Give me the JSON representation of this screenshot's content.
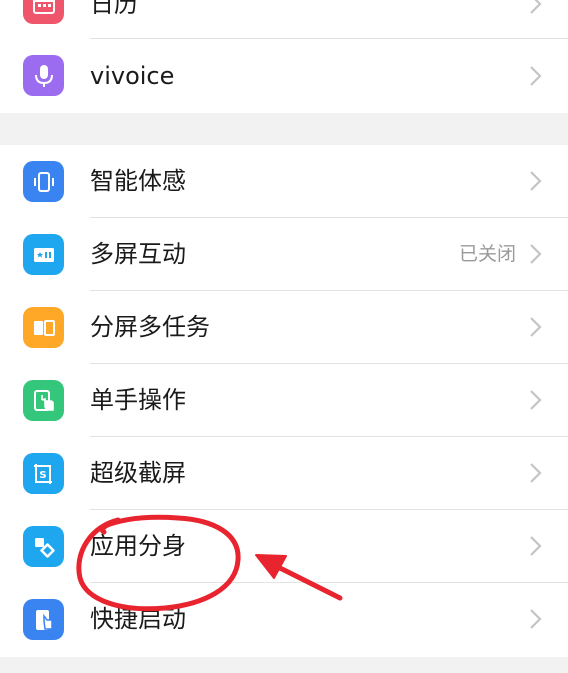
{
  "colors": {
    "calendar": "#f0566b",
    "vivoice": "#9b6cf0",
    "blue": "#3a84f2",
    "cyan": "#1ea7ee",
    "orange": "#ffa726",
    "green": "#34c77b",
    "annotation": "#e8252f"
  },
  "top_group": {
    "items": [
      {
        "label": "日历",
        "icon": "calendar-icon"
      },
      {
        "label": "vivoice",
        "icon": "microphone-icon"
      }
    ]
  },
  "main_group": {
    "items": [
      {
        "label": "智能体感",
        "icon": "phone-motion-icon",
        "status": ""
      },
      {
        "label": "多屏互动",
        "icon": "screen-cast-icon",
        "status": "已关闭"
      },
      {
        "label": "分屏多任务",
        "icon": "split-screen-icon",
        "status": ""
      },
      {
        "label": "单手操作",
        "icon": "one-hand-icon",
        "status": ""
      },
      {
        "label": "超级截屏",
        "icon": "screenshot-icon",
        "status": ""
      },
      {
        "label": "应用分身",
        "icon": "app-clone-icon",
        "status": ""
      },
      {
        "label": "快捷启动",
        "icon": "quick-launch-icon",
        "status": ""
      }
    ]
  }
}
